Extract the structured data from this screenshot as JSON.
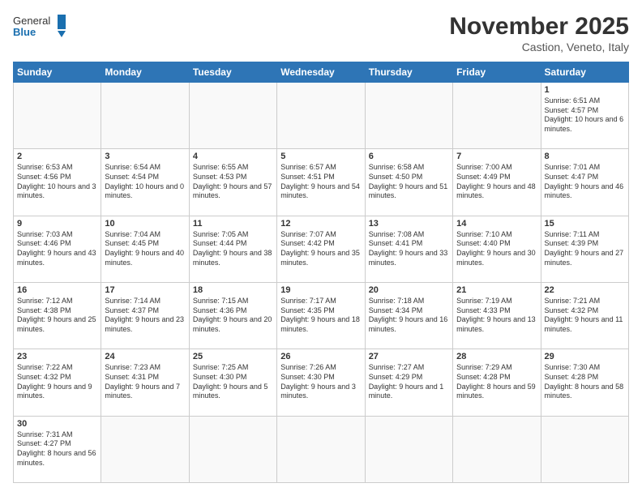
{
  "logo": {
    "text_general": "General",
    "text_blue": "Blue"
  },
  "header": {
    "month_year": "November 2025",
    "location": "Castion, Veneto, Italy"
  },
  "weekdays": [
    "Sunday",
    "Monday",
    "Tuesday",
    "Wednesday",
    "Thursday",
    "Friday",
    "Saturday"
  ],
  "weeks": [
    [
      {
        "day": "",
        "info": ""
      },
      {
        "day": "",
        "info": ""
      },
      {
        "day": "",
        "info": ""
      },
      {
        "day": "",
        "info": ""
      },
      {
        "day": "",
        "info": ""
      },
      {
        "day": "",
        "info": ""
      },
      {
        "day": "1",
        "info": "Sunrise: 6:51 AM\nSunset: 4:57 PM\nDaylight: 10 hours and 6 minutes."
      }
    ],
    [
      {
        "day": "2",
        "info": "Sunrise: 6:53 AM\nSunset: 4:56 PM\nDaylight: 10 hours and 3 minutes."
      },
      {
        "day": "3",
        "info": "Sunrise: 6:54 AM\nSunset: 4:54 PM\nDaylight: 10 hours and 0 minutes."
      },
      {
        "day": "4",
        "info": "Sunrise: 6:55 AM\nSunset: 4:53 PM\nDaylight: 9 hours and 57 minutes."
      },
      {
        "day": "5",
        "info": "Sunrise: 6:57 AM\nSunset: 4:51 PM\nDaylight: 9 hours and 54 minutes."
      },
      {
        "day": "6",
        "info": "Sunrise: 6:58 AM\nSunset: 4:50 PM\nDaylight: 9 hours and 51 minutes."
      },
      {
        "day": "7",
        "info": "Sunrise: 7:00 AM\nSunset: 4:49 PM\nDaylight: 9 hours and 48 minutes."
      },
      {
        "day": "8",
        "info": "Sunrise: 7:01 AM\nSunset: 4:47 PM\nDaylight: 9 hours and 46 minutes."
      }
    ],
    [
      {
        "day": "9",
        "info": "Sunrise: 7:03 AM\nSunset: 4:46 PM\nDaylight: 9 hours and 43 minutes."
      },
      {
        "day": "10",
        "info": "Sunrise: 7:04 AM\nSunset: 4:45 PM\nDaylight: 9 hours and 40 minutes."
      },
      {
        "day": "11",
        "info": "Sunrise: 7:05 AM\nSunset: 4:44 PM\nDaylight: 9 hours and 38 minutes."
      },
      {
        "day": "12",
        "info": "Sunrise: 7:07 AM\nSunset: 4:42 PM\nDaylight: 9 hours and 35 minutes."
      },
      {
        "day": "13",
        "info": "Sunrise: 7:08 AM\nSunset: 4:41 PM\nDaylight: 9 hours and 33 minutes."
      },
      {
        "day": "14",
        "info": "Sunrise: 7:10 AM\nSunset: 4:40 PM\nDaylight: 9 hours and 30 minutes."
      },
      {
        "day": "15",
        "info": "Sunrise: 7:11 AM\nSunset: 4:39 PM\nDaylight: 9 hours and 27 minutes."
      }
    ],
    [
      {
        "day": "16",
        "info": "Sunrise: 7:12 AM\nSunset: 4:38 PM\nDaylight: 9 hours and 25 minutes."
      },
      {
        "day": "17",
        "info": "Sunrise: 7:14 AM\nSunset: 4:37 PM\nDaylight: 9 hours and 23 minutes."
      },
      {
        "day": "18",
        "info": "Sunrise: 7:15 AM\nSunset: 4:36 PM\nDaylight: 9 hours and 20 minutes."
      },
      {
        "day": "19",
        "info": "Sunrise: 7:17 AM\nSunset: 4:35 PM\nDaylight: 9 hours and 18 minutes."
      },
      {
        "day": "20",
        "info": "Sunrise: 7:18 AM\nSunset: 4:34 PM\nDaylight: 9 hours and 16 minutes."
      },
      {
        "day": "21",
        "info": "Sunrise: 7:19 AM\nSunset: 4:33 PM\nDaylight: 9 hours and 13 minutes."
      },
      {
        "day": "22",
        "info": "Sunrise: 7:21 AM\nSunset: 4:32 PM\nDaylight: 9 hours and 11 minutes."
      }
    ],
    [
      {
        "day": "23",
        "info": "Sunrise: 7:22 AM\nSunset: 4:32 PM\nDaylight: 9 hours and 9 minutes."
      },
      {
        "day": "24",
        "info": "Sunrise: 7:23 AM\nSunset: 4:31 PM\nDaylight: 9 hours and 7 minutes."
      },
      {
        "day": "25",
        "info": "Sunrise: 7:25 AM\nSunset: 4:30 PM\nDaylight: 9 hours and 5 minutes."
      },
      {
        "day": "26",
        "info": "Sunrise: 7:26 AM\nSunset: 4:30 PM\nDaylight: 9 hours and 3 minutes."
      },
      {
        "day": "27",
        "info": "Sunrise: 7:27 AM\nSunset: 4:29 PM\nDaylight: 9 hours and 1 minute."
      },
      {
        "day": "28",
        "info": "Sunrise: 7:29 AM\nSunset: 4:28 PM\nDaylight: 8 hours and 59 minutes."
      },
      {
        "day": "29",
        "info": "Sunrise: 7:30 AM\nSunset: 4:28 PM\nDaylight: 8 hours and 58 minutes."
      }
    ],
    [
      {
        "day": "30",
        "info": "Sunrise: 7:31 AM\nSunset: 4:27 PM\nDaylight: 8 hours and 56 minutes."
      },
      {
        "day": "",
        "info": ""
      },
      {
        "day": "",
        "info": ""
      },
      {
        "day": "",
        "info": ""
      },
      {
        "day": "",
        "info": ""
      },
      {
        "day": "",
        "info": ""
      },
      {
        "day": "",
        "info": ""
      }
    ]
  ]
}
